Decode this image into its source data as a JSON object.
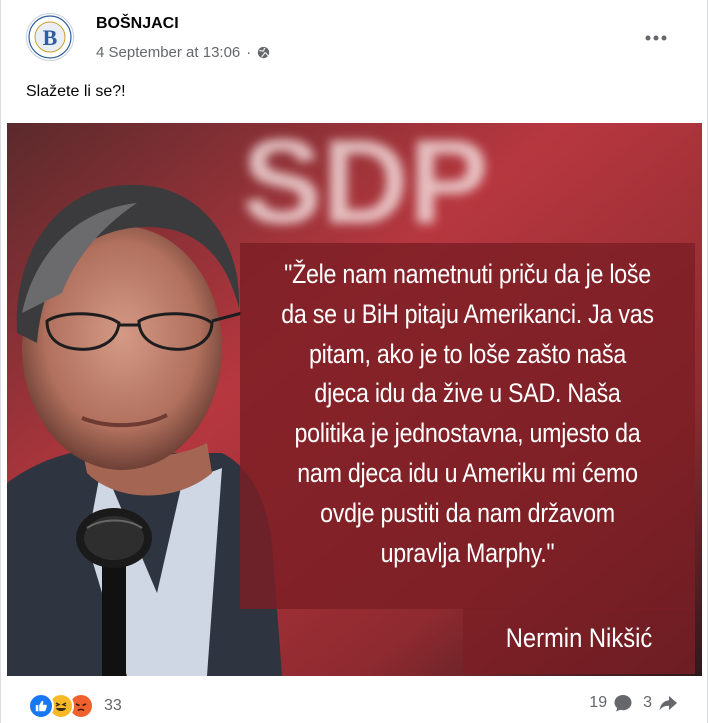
{
  "post": {
    "author": "BOŠNJACI",
    "timestamp": "4 September at 13:06",
    "separator": "·",
    "caption": "Slažete li se?!",
    "avatar_letter": "B"
  },
  "image": {
    "background_text": "SDP",
    "quote": "\"Žele nam nametnuti priču da je loše da se u BiH pitaju Amerikanci. Ja vas pitam, ako je to loše zašto naša djeca idu da žive u SAD. Naša politika je jednostavna, umjesto da nam djeca idu u Ameriku mi ćemo ovdje pustiti da nam državom upravlja Marphy.\"",
    "signature": "Nermin Nikšić"
  },
  "footer": {
    "reaction_count": "33",
    "comment_count": "19",
    "share_count": "3"
  },
  "colors": {
    "overlay": "#7b1e24",
    "like_blue": "#1877f2",
    "angry_orange": "#f0612d",
    "haha_yellow": "#f7b928"
  }
}
